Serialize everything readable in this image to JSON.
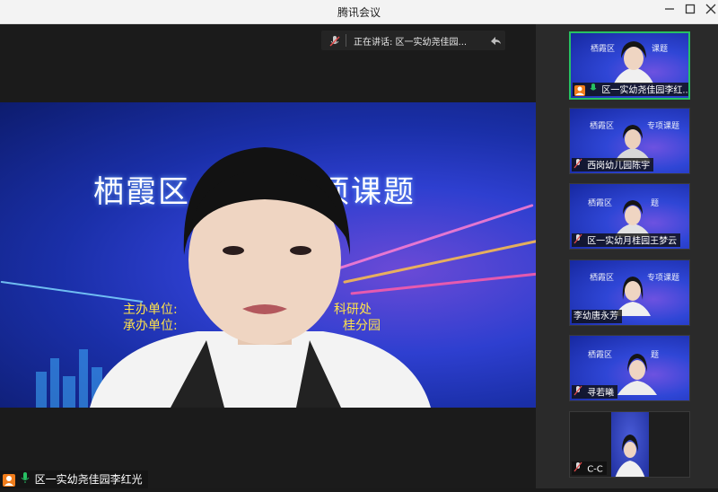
{
  "window": {
    "title": "腾讯会议",
    "controls": [
      "minimize",
      "maximize",
      "close"
    ]
  },
  "speaking": {
    "label": "正在讲话: 区一实幼尧佳园..."
  },
  "slide": {
    "title_left": "栖霞区",
    "title_right": "项课题",
    "line1_label": "主办单位:",
    "line1_tail": "科研处",
    "line2_label": "承办单位:",
    "line2_tail": "桂分园"
  },
  "main_speaker": {
    "name": "区一实幼尧佳园李红光"
  },
  "participants": [
    {
      "name": "区一实幼尧佳园李红...",
      "active": true,
      "mic": "on"
    },
    {
      "name": "西岗幼儿园陈宇",
      "active": false,
      "mic": "muted"
    },
    {
      "name": "区一实幼月桂园王梦云",
      "active": false,
      "mic": "muted"
    },
    {
      "name": "李幼唐永芳",
      "active": false,
      "mic": "none"
    },
    {
      "name": "寻若曦",
      "active": false,
      "mic": "muted"
    },
    {
      "name": "C-C",
      "active": false,
      "mic": "muted"
    }
  ],
  "colors": {
    "accent_green": "#27c163",
    "slide_yellow": "#ffe34a",
    "avatar_orange": "#f07c1a"
  },
  "icons": [
    "mic-muted-icon",
    "mic-on-icon",
    "hand-raise-icon",
    "avatar-icon",
    "minimize-icon",
    "maximize-icon",
    "close-icon"
  ]
}
